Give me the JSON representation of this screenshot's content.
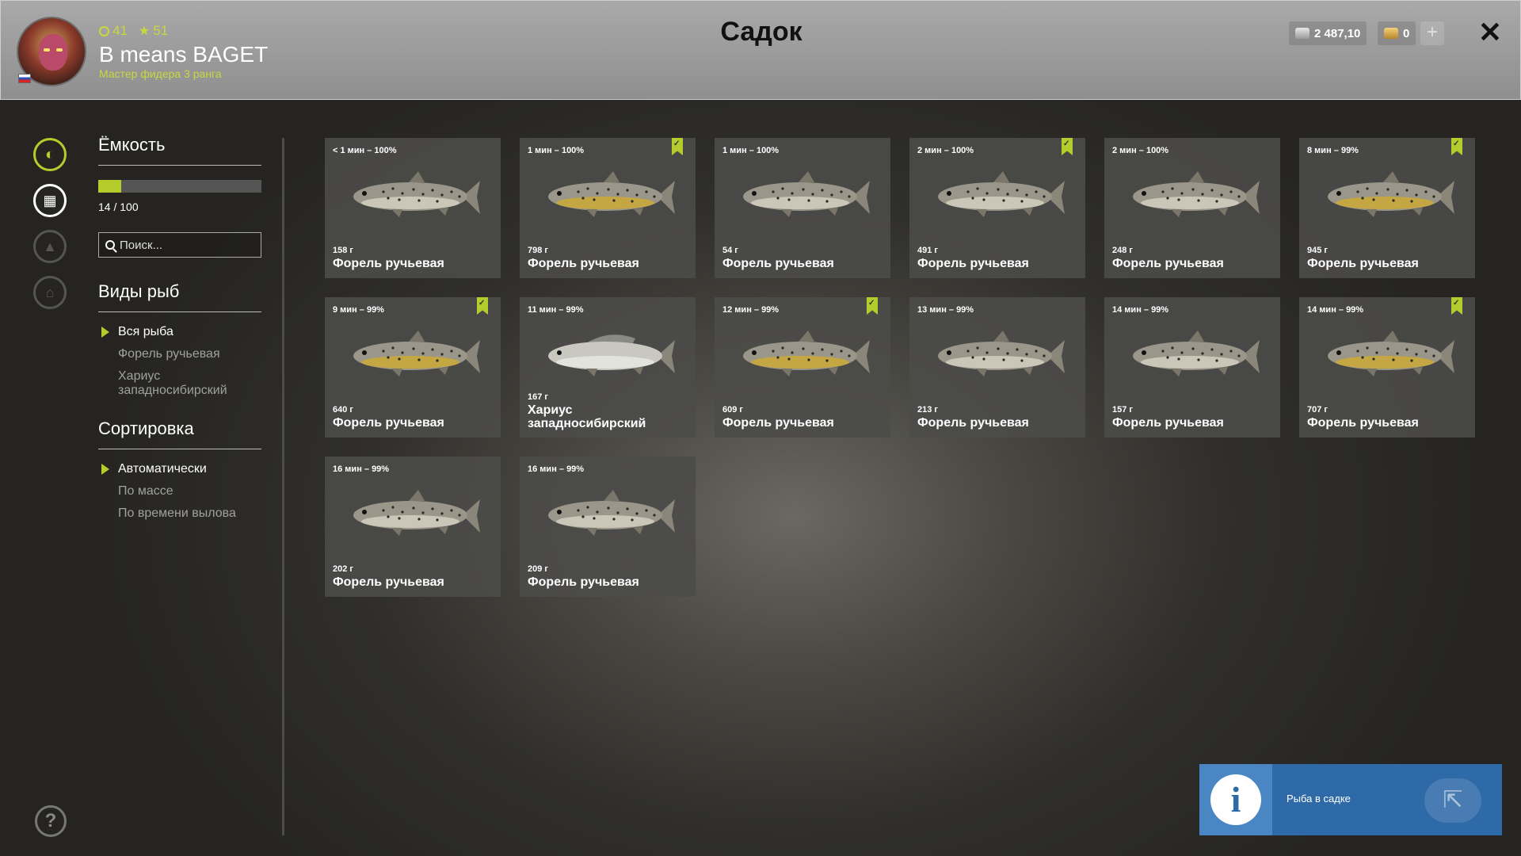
{
  "header": {
    "title": "Садок",
    "player": {
      "level": "41",
      "stars": "51",
      "name": "B means BAGET",
      "rank": "Мастер фидера 3 ранга"
    },
    "currency": {
      "silver": "2 487,10",
      "gold": "0",
      "add_label": "+"
    },
    "close_label": "✕"
  },
  "panel": {
    "capacity": {
      "title": "Ёмкость",
      "fill_fraction": 0.14,
      "text": "14 / 100"
    },
    "search": {
      "placeholder": "Поиск..."
    },
    "species": {
      "title": "Виды рыб",
      "items": [
        {
          "label": "Вся рыба",
          "selected": true
        },
        {
          "label": "Форель ручьевая",
          "selected": false
        },
        {
          "label": "Хариус западносибирский",
          "selected": false
        }
      ]
    },
    "sorting": {
      "title": "Сортировка",
      "items": [
        {
          "label": "Автоматически",
          "selected": true
        },
        {
          "label": "По массе",
          "selected": false
        },
        {
          "label": "По времени вылова",
          "selected": false
        }
      ]
    }
  },
  "fish": [
    {
      "time": "< 1 мин – 100%",
      "weight": "158 г",
      "name": "Форель ручьевая",
      "bookmarked": false,
      "kind": "trout"
    },
    {
      "time": "1 мин – 100%",
      "weight": "798 г",
      "name": "Форель ручьевая",
      "bookmarked": true,
      "kind": "trout-yellow"
    },
    {
      "time": "1 мин – 100%",
      "weight": "54 г",
      "name": "Форель ручьевая",
      "bookmarked": false,
      "kind": "trout"
    },
    {
      "time": "2 мин – 100%",
      "weight": "491 г",
      "name": "Форель ручьевая",
      "bookmarked": true,
      "kind": "trout"
    },
    {
      "time": "2 мин – 100%",
      "weight": "248 г",
      "name": "Форель ручьевая",
      "bookmarked": false,
      "kind": "trout"
    },
    {
      "time": "8 мин – 99%",
      "weight": "945 г",
      "name": "Форель ручьевая",
      "bookmarked": true,
      "kind": "trout-yellow"
    },
    {
      "time": "9 мин – 99%",
      "weight": "640 г",
      "name": "Форель ручьевая",
      "bookmarked": true,
      "kind": "trout-yellow"
    },
    {
      "time": "11 мин – 99%",
      "weight": "167 г",
      "name": "Хариус западносибирский",
      "bookmarked": false,
      "kind": "grayling"
    },
    {
      "time": "12 мин – 99%",
      "weight": "609 г",
      "name": "Форель ручьевая",
      "bookmarked": true,
      "kind": "trout-yellow"
    },
    {
      "time": "13 мин – 99%",
      "weight": "213 г",
      "name": "Форель ручьевая",
      "bookmarked": false,
      "kind": "trout"
    },
    {
      "time": "14 мин – 99%",
      "weight": "157 г",
      "name": "Форель ручьевая",
      "bookmarked": false,
      "kind": "trout"
    },
    {
      "time": "14 мин – 99%",
      "weight": "707 г",
      "name": "Форель ручьевая",
      "bookmarked": true,
      "kind": "trout-yellow"
    },
    {
      "time": "16 мин – 99%",
      "weight": "202 г",
      "name": "Форель ручьевая",
      "bookmarked": false,
      "kind": "trout"
    },
    {
      "time": "16 мин – 99%",
      "weight": "209 г",
      "name": "Форель ручьевая",
      "bookmarked": false,
      "kind": "trout"
    }
  ],
  "notification": {
    "text": "Рыба в садке"
  },
  "colors": {
    "accent": "#b4cc2c",
    "trout_body": "#9a968a",
    "trout_yellow": "#c9a83a",
    "grayling_body": "#c8c8c0",
    "notification_bg": "#2f6aa8"
  }
}
